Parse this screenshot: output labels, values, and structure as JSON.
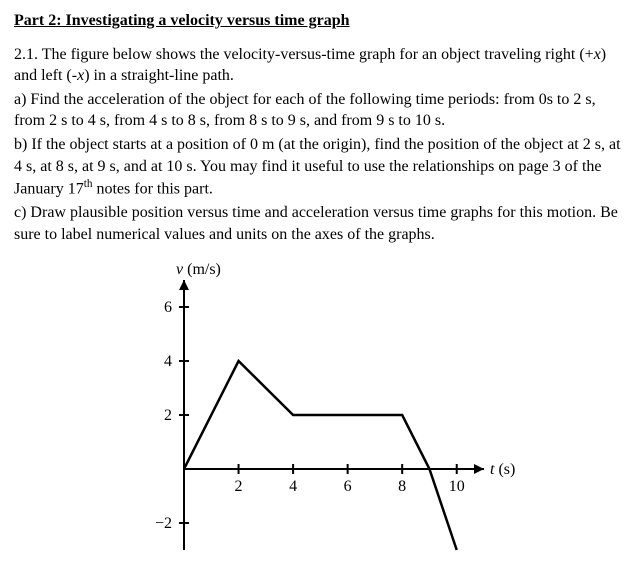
{
  "title": "Part 2: Investigating a velocity versus time graph",
  "intro_a": "2.1. The figure below shows the velocity-versus-time graph for an object traveling right (+",
  "intro_b": ") and left (-",
  "intro_c": ") in a straight-line path.",
  "x_var": "x",
  "part_a": "a) Find the acceleration of the object for each of the following time periods: from 0s to 2 s, from 2 s to 4 s, from 4 s to 8 s, from 8 s to 9 s, and from 9 s to 10 s.",
  "part_b_1": "b) If the object starts at a position of 0 m (at the origin), find the position of the object at 2 s, at 4 s, at 8 s, at 9 s, and at 10 s.  You may find it useful to use the relationships on page 3 of the January 17",
  "part_b_sup": "th",
  "part_b_2": " notes for this part.",
  "part_c": "c) Draw plausible position versus time and acceleration versus time graphs for this motion.  Be sure to label numerical values and units on the axes of the graphs.",
  "chart_data": {
    "type": "line",
    "title": "",
    "xlabel": "t (s)",
    "ylabel": "v (m/s)",
    "xlim": [
      0,
      11
    ],
    "ylim": [
      -3,
      7
    ],
    "x_ticks": [
      2,
      4,
      6,
      8,
      10
    ],
    "y_ticks": [
      -2,
      2,
      4,
      6
    ],
    "x": [
      0,
      2,
      4,
      8,
      9,
      10
    ],
    "values": [
      0,
      4,
      2,
      2,
      0,
      -3
    ]
  }
}
